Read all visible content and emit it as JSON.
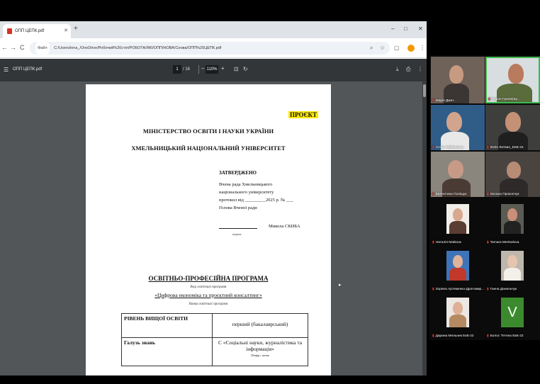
{
  "browser": {
    "tab_title": "ОПП ЦЕПК.pdf",
    "tab_close": "✕",
    "new_tab": "+",
    "window_controls": {
      "minimize": "–",
      "maximize": "□",
      "close": "✕"
    },
    "nav": {
      "back": "←",
      "forward": "→",
      "reload": "C"
    },
    "address_chip": "Файл",
    "address": "C:/Users/inna_/OneDrive/Робочий%20стіл/РОБОТА/ЯКІ/ОПП/НОВА/Снова/ОПП%20ЦЕПК.pdf",
    "toolbar_icons": [
      "zoom-icon",
      "star-icon",
      "extension-icon",
      "menu-icon"
    ],
    "accent_color": "#f29900"
  },
  "pdf": {
    "menu_icon": "☰",
    "file_name": "ОПП ЦЕПК.pdf",
    "page_current": "1",
    "page_total": "/ 16",
    "zoom_minus": "–",
    "zoom_value": "110%",
    "zoom_plus": "+",
    "icons": {
      "fit": "⊡",
      "rotate": "↻",
      "download": "⤓",
      "print": "⎙",
      "more": "⋮"
    }
  },
  "document": {
    "stamp": "ПРОЄКТ",
    "ministry": "МІНІСТЕРСТВО ОСВІТИ І НАУКИ УКРАЇНИ",
    "university": "ХМЕЛЬНИЦЬКИЙ НАЦІОНАЛЬНИЙ УНІВЕРСИТЕТ",
    "approve_title": "ЗАТВЕРДЖЕНО",
    "approve_lines": [
      "Вчена рада Хмельницького",
      "національного університету",
      "протокол від _________2025 р. № ___",
      "Голова Вченої ради"
    ],
    "signatory": "Микола СКИБА",
    "signature_caption": "підпис",
    "program_type": "ОСВІТНЬО-ПРОФЕСІЙНА ПРОГРАМА",
    "program_type_caption": "Вид освітньої програми",
    "program_name": "«Цифрова економіка та проєктний консалтинг»",
    "program_name_caption": "Назва освітньої програми",
    "table": [
      {
        "label": "РІВЕНЬ ВИЩОЇ ОСВІТИ",
        "value": "перший (бакалаврський)",
        "caption": ""
      },
      {
        "label": "Галузь знань",
        "value": "С «Соціальні науки, журналістика та інформація»",
        "caption": "Шифр і назва"
      }
    ]
  },
  "participants": [
    {
      "name": "Марія Дмит..."
    },
    {
      "name": "Павло Гринів(Бу..."
    },
    {
      "name": "Аліна Чайковська"
    },
    {
      "name": "Юлія Литвин_ЕКБ-24"
    },
    {
      "name": "Валентина Поліщук"
    },
    {
      "name": "Оксана Прокопчук"
    },
    {
      "name": "Наталія Майсюк"
    },
    {
      "name": "Tamara Mertsalova"
    },
    {
      "name": "Зоряна Артеменко-Дрогомир..."
    },
    {
      "name": "Ганна Данильчук"
    },
    {
      "name": "Дарина Мельник ЕкБ-22"
    },
    {
      "name": "Болос Тетяна ЕкБ-22",
      "initial": "V"
    }
  ],
  "mic_muted_color": "#e53935"
}
